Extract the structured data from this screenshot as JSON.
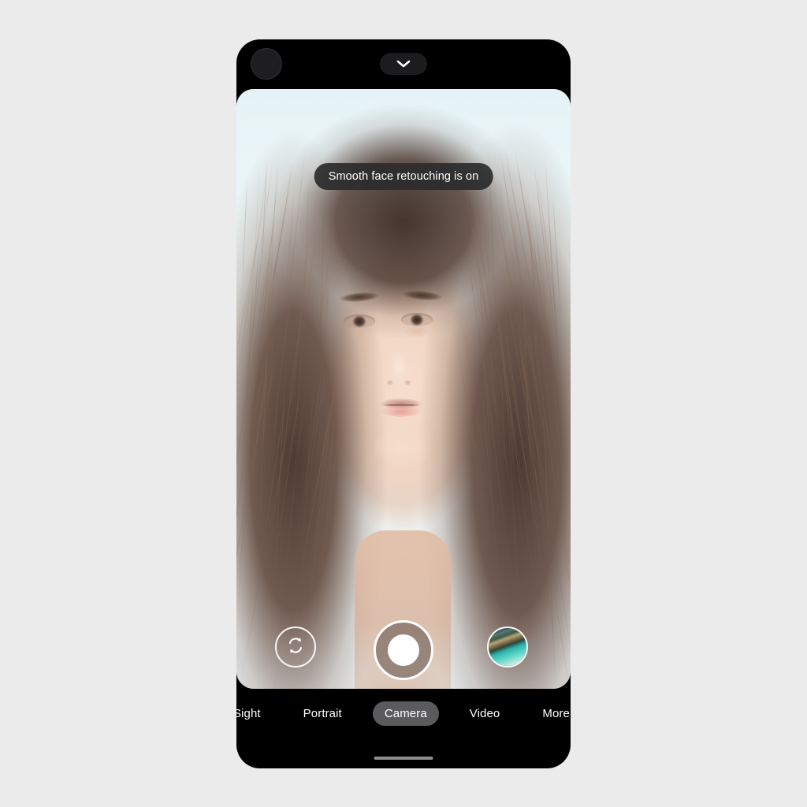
{
  "app": {
    "name": "Camera",
    "device_frame_color": "#000000",
    "page_background": "#ebebeb"
  },
  "status_bar": {
    "front_lens_icon": "camera-lens-icon",
    "expand_button_icon": "chevron-down-icon"
  },
  "viewfinder": {
    "subject": "portrait of a woman facing the camera",
    "background_description": "light blue-white backdrop",
    "toast": {
      "message": "Smooth face retouching is on",
      "background_color": "#2b2b2d",
      "text_color": "#ffffff"
    }
  },
  "controls": {
    "flip_camera": {
      "label": "Flip camera",
      "icon": "camera-flip-icon"
    },
    "shutter": {
      "label": "Shutter",
      "icon": "shutter-icon",
      "ring_color": "#ffffff",
      "inner_color": "#ffffff"
    },
    "gallery": {
      "label": "Gallery",
      "icon": "gallery-thumbnail-icon",
      "thumbnail_description": "coastal beach with turquoise water and cliffs"
    }
  },
  "mode_tabs": {
    "selected": "Camera",
    "selected_pill_color": "#5b5b5e",
    "items": [
      {
        "label": "ht Sight",
        "full_label": "Night Sight",
        "selected": false,
        "truncated": true
      },
      {
        "label": "Portrait",
        "full_label": "Portrait",
        "selected": false,
        "truncated": false
      },
      {
        "label": "Camera",
        "full_label": "Camera",
        "selected": true,
        "truncated": false
      },
      {
        "label": "Video",
        "full_label": "Video",
        "selected": false,
        "truncated": false
      },
      {
        "label": "More",
        "full_label": "More",
        "selected": false,
        "truncated": false
      }
    ]
  },
  "system_nav": {
    "home_indicator_color": "#8d8d8f"
  }
}
